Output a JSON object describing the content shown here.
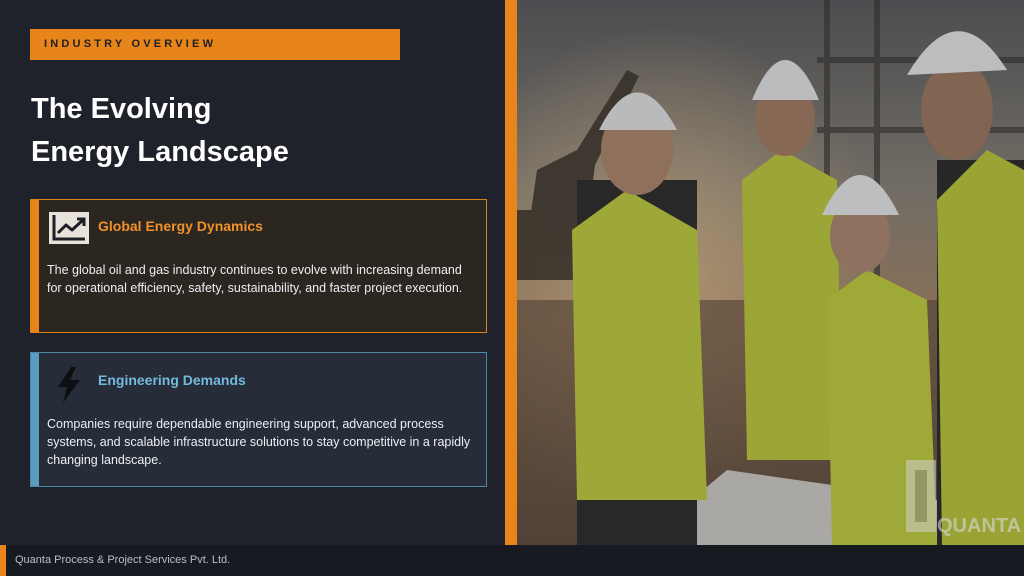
{
  "slide": {
    "tag": "INDUSTRY OVERVIEW",
    "title_line1": "The Evolving",
    "title_line2": "Energy Landscape"
  },
  "cards": [
    {
      "heading": "Global Energy Dynamics",
      "body": "The global oil and gas industry continues to evolve with increasing demand for operational efficiency, safety, sustainability, and faster project execution.",
      "icon": "trend-chart-icon",
      "accent": "#e8851a"
    },
    {
      "heading": "Engineering Demands",
      "body": "Companies require dependable engineering support, advanced process systems, and scalable infrastructure solutions to stay competitive in a rapidly changing landscape.",
      "icon": "lightning-bolt-icon",
      "accent": "#5c9cc0"
    }
  ],
  "photo": {
    "watermark": "QUANTA"
  },
  "footer": {
    "company": "Quanta Process & Project Services Pvt. Ltd."
  },
  "colors": {
    "background": "#1f222a",
    "orange": "#e8851a",
    "blue": "#5c9cc0"
  }
}
